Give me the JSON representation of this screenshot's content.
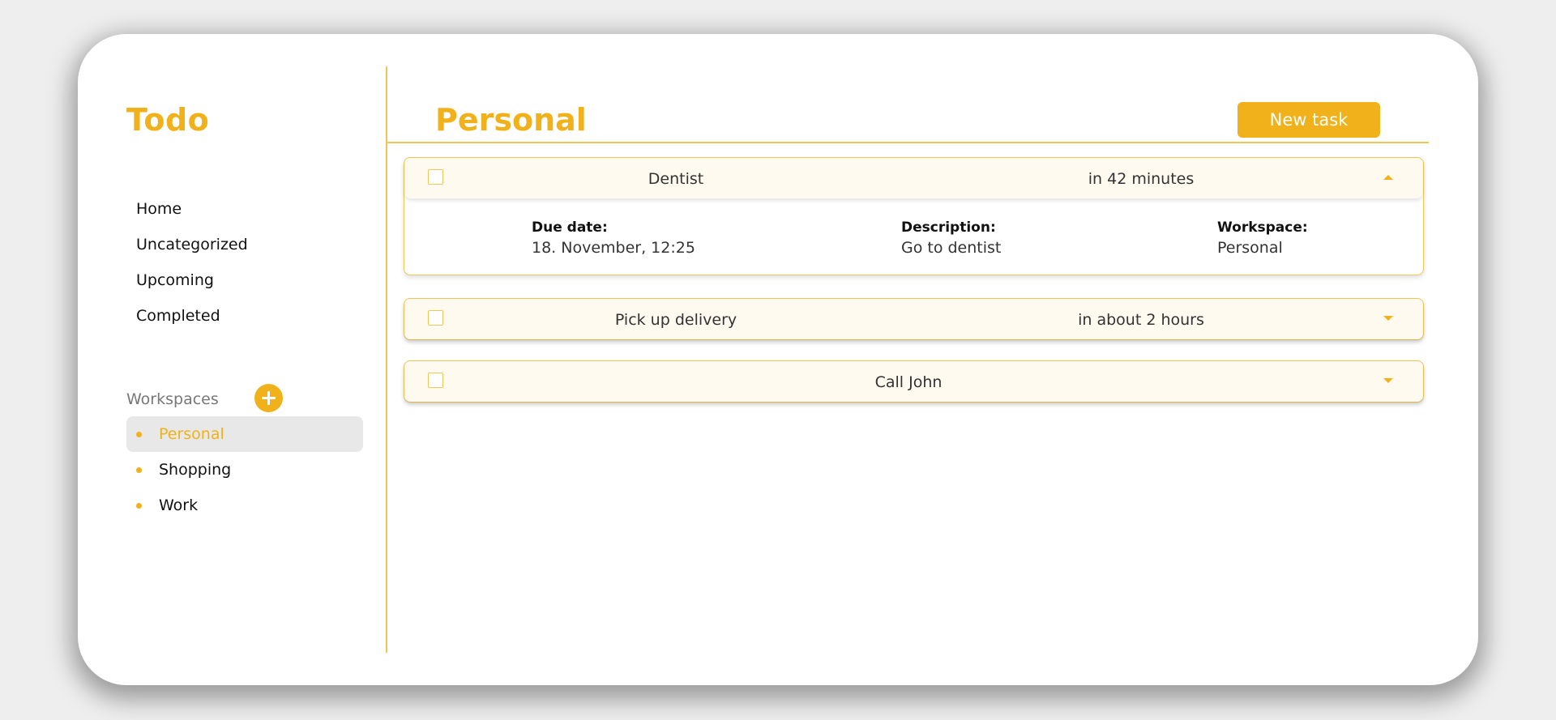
{
  "app": {
    "title": "Todo"
  },
  "nav": {
    "items": [
      {
        "label": "Home"
      },
      {
        "label": "Uncategorized"
      },
      {
        "label": "Upcoming"
      },
      {
        "label": "Completed"
      }
    ]
  },
  "workspaces": {
    "label": "Workspaces",
    "add_icon": "plus-icon",
    "items": [
      {
        "label": "Personal",
        "active": true
      },
      {
        "label": "Shopping",
        "active": false
      },
      {
        "label": "Work",
        "active": false
      }
    ]
  },
  "main": {
    "title": "Personal",
    "new_task_label": "New task"
  },
  "tasks": [
    {
      "name": "Dentist",
      "when": "in 42 minutes",
      "expanded": true,
      "toggle_icon": "chevron-up-icon",
      "details": {
        "due_label": "Due date:",
        "due_value": "18. November, 12:25",
        "desc_label": "Description:",
        "desc_value": "Go to dentist",
        "ws_label": "Workspace:",
        "ws_value": "Personal"
      }
    },
    {
      "name": "Pick up delivery",
      "when": "in about 2 hours",
      "expanded": false,
      "toggle_icon": "chevron-down-icon"
    },
    {
      "name": "Call John",
      "when": "",
      "expanded": false,
      "toggle_icon": "chevron-down-icon"
    }
  ],
  "colors": {
    "accent": "#f0b11b",
    "border": "#f0c657",
    "task_header_bg": "#fffaf0",
    "active_bg": "#e8e8e8",
    "page_bg": "#eeeeee"
  }
}
